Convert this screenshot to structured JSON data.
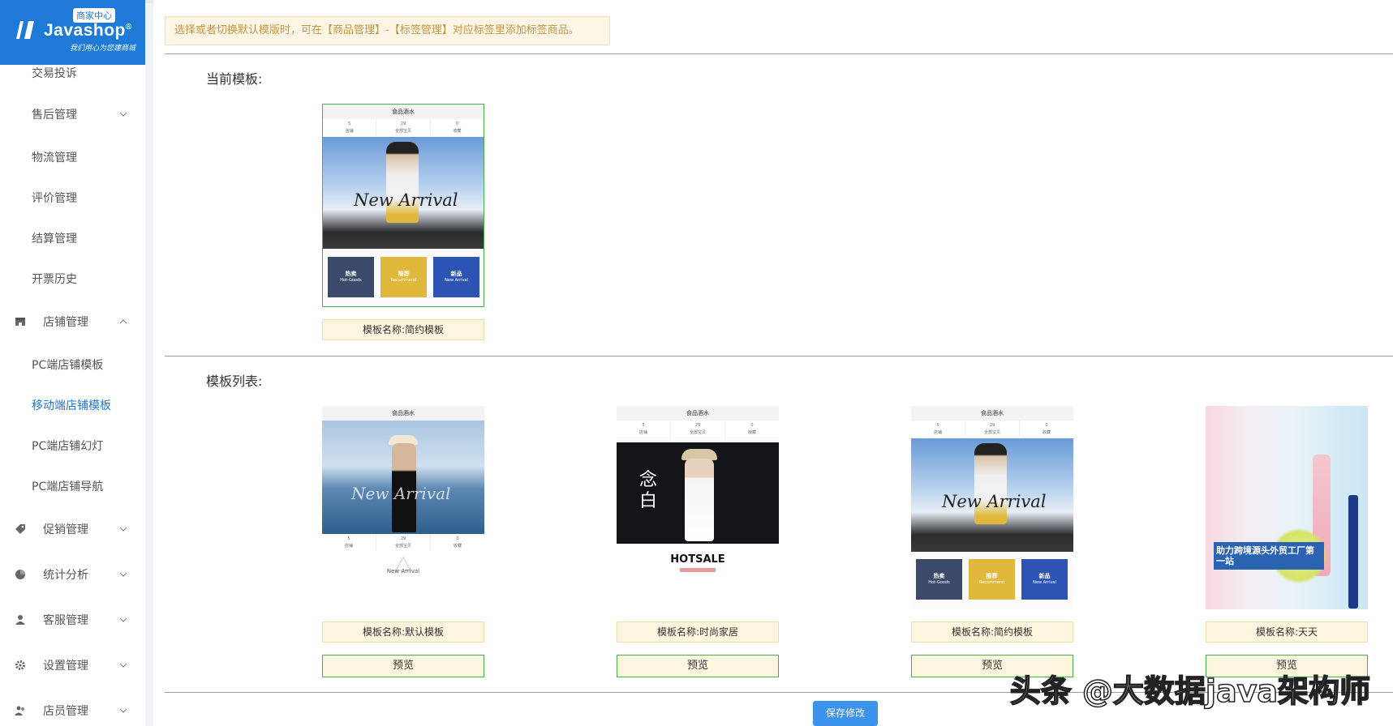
{
  "brand": {
    "badge": "商家中心",
    "name": "Javashop",
    "reg": "®",
    "slogan": "我们用心为您建商城"
  },
  "sidebar": {
    "items": [
      {
        "label": "交易投诉"
      },
      {
        "label": "售后管理"
      },
      {
        "label": "物流管理"
      },
      {
        "label": "评价管理"
      },
      {
        "label": "结算管理"
      },
      {
        "label": "开票历史"
      },
      {
        "label": "店铺管理",
        "icon": "store-icon"
      },
      {
        "label": "PC端店铺模板"
      },
      {
        "label": "移动端店铺模板"
      },
      {
        "label": "PC端店铺幻灯"
      },
      {
        "label": "PC端店铺导航"
      },
      {
        "label": "促销管理",
        "icon": "tag-icon"
      },
      {
        "label": "统计分析",
        "icon": "pie-chart-icon"
      },
      {
        "label": "客服管理",
        "icon": "user-icon"
      },
      {
        "label": "设置管理",
        "icon": "gear-icon"
      },
      {
        "label": "店员管理",
        "icon": "team-icon"
      }
    ],
    "active_color": "#1e7ad6"
  },
  "notice": "选择或者切换默认模版时，可在【商品管理】-【标签管理】对应标签里添加标签商品。",
  "current": {
    "title": "当前模板:",
    "template_name": "模板名称:简约模板"
  },
  "list": {
    "title": "模板列表:",
    "templates": [
      {
        "name": "模板名称:默认模板",
        "preview": "预览"
      },
      {
        "name": "模板名称:时尚家居",
        "preview": "预览"
      },
      {
        "name": "模板名称:简约模板",
        "preview": "预览"
      },
      {
        "name": "模板名称:天天",
        "preview": "预览"
      }
    ]
  },
  "thumb": {
    "header": "食品酒水",
    "stats": [
      "5\n店铺",
      "29\n全部宝贝",
      "0\n收藏"
    ],
    "hero_text": "New Arrival",
    "tiles": [
      {
        "title": "热卖",
        "sub": "Hot-Goods",
        "color": "#3b4a6b"
      },
      {
        "title": "推荐",
        "sub": "Recommend",
        "color": "#e0b93c"
      },
      {
        "title": "新品",
        "sub": "New Arrival",
        "color": "#2d53b5"
      }
    ],
    "hotsale": "HOTSALE",
    "calligraphy": "念白",
    "new_arrival_small": "New Arrival",
    "banner_text": "助力跨境源头外贸工厂第一站"
  },
  "save_button": "保存修改",
  "watermark": "头条 @大数据java架构师"
}
